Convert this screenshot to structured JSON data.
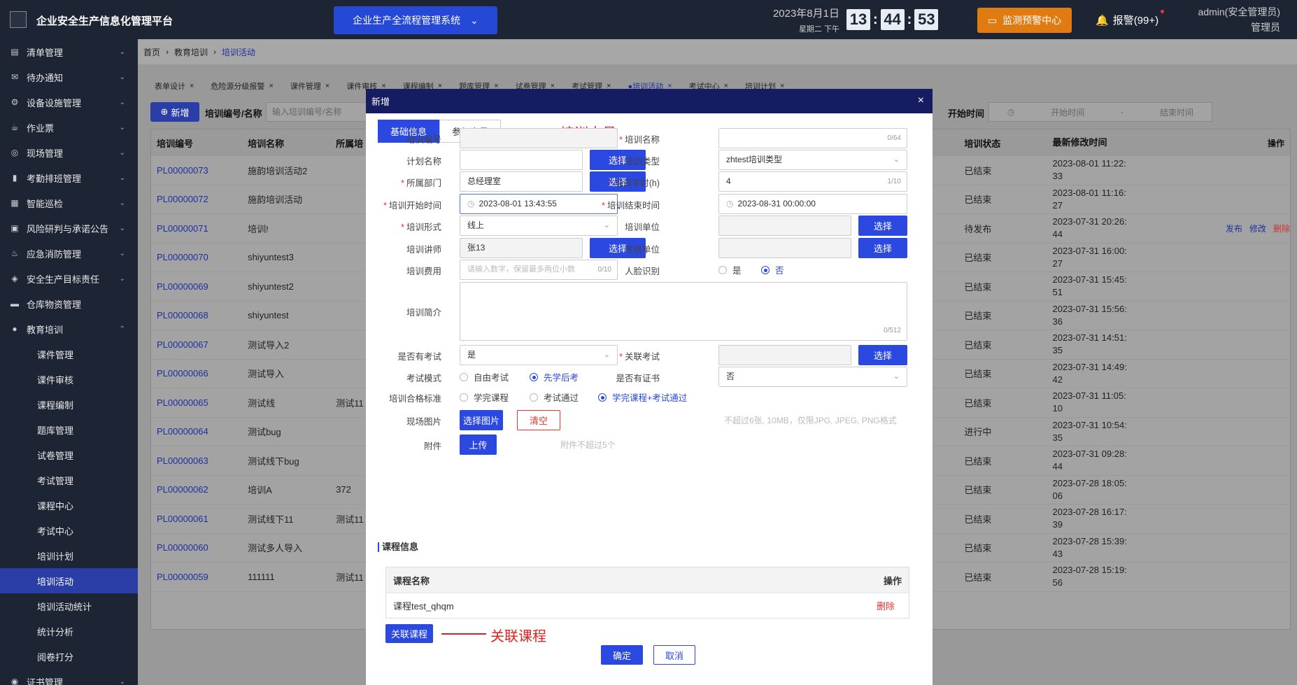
{
  "header": {
    "title": "企业安全生产信息化管理平台",
    "system_btn": "企业生产全流程管理系统",
    "date": "2023年8月1日",
    "weekday": "星期二  下午",
    "clock": {
      "h": "13",
      "m": "44",
      "s": "53"
    },
    "monitor_btn": "监测预警中心",
    "alarm": "报警(99+)",
    "user": "admin(安全管理员)",
    "role": "管理员"
  },
  "sidebar": {
    "items": [
      {
        "label": "清单管理",
        "icon": "clipboard-icon"
      },
      {
        "label": "待办通知",
        "icon": "mail-icon"
      },
      {
        "label": "设备设施管理",
        "icon": "sitemap-icon"
      },
      {
        "label": "作业票",
        "icon": "ticket-icon"
      },
      {
        "label": "现场管理",
        "icon": "globe-icon"
      },
      {
        "label": "考勤排班管理",
        "icon": "bar-chart-icon"
      },
      {
        "label": "智能巡检",
        "icon": "grid-icon"
      },
      {
        "label": "风险研判与承诺公告",
        "icon": "briefcase-icon"
      },
      {
        "label": "应急消防管理",
        "icon": "extinguisher-icon"
      },
      {
        "label": "安全生产目标责任",
        "icon": "target-icon"
      },
      {
        "label": "仓库物资管理",
        "icon": "folder-icon"
      },
      {
        "label": "教育培训",
        "icon": "user-icon"
      }
    ],
    "sub": [
      "课件管理",
      "课件审核",
      "课程编制",
      "题库管理",
      "试卷管理",
      "考试管理",
      "课程中心",
      "考试中心",
      "培训计划",
      "培训活动",
      "培训活动统计",
      "统计分析",
      "阅卷打分"
    ],
    "last": "证书管理"
  },
  "breadcrumb": [
    "首页",
    "教育培训",
    "培训活动"
  ],
  "tabs": [
    "表单设计",
    "危险源分级报警",
    "课件管理",
    "课件审核",
    "课程编制",
    "题库管理",
    "试卷管理",
    "考试管理",
    "●培训活动",
    "考试中心",
    "培训计划"
  ],
  "toolbar": {
    "add": "新增",
    "code_label": "培训编号/名称",
    "code_ph": "输入培训编号/名称",
    "time_label": "开始时间",
    "start_ph": "开始时间",
    "range_sep": "-",
    "end_ph": "结束时间"
  },
  "table": {
    "headers": [
      "培训编号",
      "培训名称",
      "所属培",
      "培训状态",
      "最新修改时间",
      "操作"
    ],
    "rows": [
      {
        "code": "PL00000073",
        "name": "施韵培训活动2",
        "dept": "",
        "status": "已结束",
        "t1": "2023-08-01 11:22:",
        "t2": "33",
        "ops": []
      },
      {
        "code": "PL00000072",
        "name": "施韵培训活动",
        "dept": "",
        "status": "已结束",
        "t1": "2023-08-01 11:16:",
        "t2": "27",
        "ops": []
      },
      {
        "code": "PL00000071",
        "name": "培训!",
        "dept": "",
        "status": "待发布",
        "t1": "2023-07-31 20:26:",
        "t2": "44",
        "ops": [
          "发布",
          "修改",
          "删除"
        ]
      },
      {
        "code": "PL00000070",
        "name": "shiyuntest3",
        "dept": "",
        "status": "已结束",
        "t1": "2023-07-31 16:00:",
        "t2": "27",
        "ops": []
      },
      {
        "code": "PL00000069",
        "name": "shiyuntest2",
        "dept": "",
        "status": "已结束",
        "t1": "2023-07-31 15:45:",
        "t2": "51",
        "ops": []
      },
      {
        "code": "PL00000068",
        "name": "shiyuntest",
        "dept": "",
        "status": "已结束",
        "t1": "2023-07-31 15:56:",
        "t2": "36",
        "ops": []
      },
      {
        "code": "PL00000067",
        "name": "测试导入2",
        "dept": "",
        "status": "已结束",
        "t1": "2023-07-31 14:51:",
        "t2": "35",
        "ops": []
      },
      {
        "code": "PL00000066",
        "name": "测试导入",
        "dept": "",
        "status": "已结束",
        "t1": "2023-07-31 14:49:",
        "t2": "42",
        "ops": []
      },
      {
        "code": "PL00000065",
        "name": "测试线",
        "dept": "测试11",
        "status": "已结束",
        "t1": "2023-07-31 11:05:",
        "t2": "10",
        "ops": []
      },
      {
        "code": "PL00000064",
        "name": "测试bug",
        "dept": "",
        "status": "进行中",
        "t1": "2023-07-31 10:54:",
        "t2": "35",
        "ops": []
      },
      {
        "code": "PL00000063",
        "name": "测试线下bug",
        "dept": "",
        "status": "已结束",
        "t1": "2023-07-31 09:28:",
        "t2": "44",
        "ops": []
      },
      {
        "code": "PL00000062",
        "name": "培训A",
        "dept": "372",
        "status": "已结束",
        "t1": "2023-07-28 18:05:",
        "t2": "06",
        "ops": []
      },
      {
        "code": "PL00000061",
        "name": "测试线下11",
        "dept": "测试11",
        "status": "已结束",
        "t1": "2023-07-28 16:17:",
        "t2": "39",
        "ops": []
      },
      {
        "code": "PL00000060",
        "name": "测试多人导入",
        "dept": "",
        "status": "已结束",
        "t1": "2023-07-28 15:39:",
        "t2": "43",
        "ops": []
      },
      {
        "code": "PL00000059",
        "name": "111111",
        "dept": "测试11",
        "status": "已结束",
        "t1": "2023-07-28 15:19:",
        "t2": "56",
        "ops": []
      }
    ]
  },
  "modal": {
    "title": "新增",
    "close": "×",
    "tabs": [
      "基础信息",
      "参与人员"
    ],
    "anno_people": "培训人员",
    "anno_course": "关联课程",
    "labels": {
      "code": "培训编号",
      "name": "培训名称",
      "plan": "计划名称",
      "type": "培训类型",
      "dept": "所属部门",
      "hours": "培训学时(h)",
      "start": "培训开始时间",
      "end": "培训结束时间",
      "form": "培训形式",
      "unit": "培训单位",
      "teacher": "培训讲师",
      "exam_unit": "考核单位",
      "fee": "培训费用",
      "face": "人脸识别",
      "intro": "培训简介",
      "has_exam": "是否有考试",
      "rel_exam": "关联考试",
      "exam_mode": "考试模式",
      "has_cert": "是否有证书",
      "pass": "培训合格标准",
      "photo": "现场图片",
      "attach": "附件"
    },
    "values": {
      "name_cnt": "0/64",
      "type": "zhtest培训类型",
      "dept": "总经理室",
      "hours": "4",
      "hours_cnt": "1/10",
      "start": "2023-08-01 13:43:55",
      "end": "2023-08-31 00:00:00",
      "form": "线上",
      "teacher": "张13",
      "fee_ph": "请输入数字，保留最多两位小数",
      "fee_cnt": "0/10",
      "intro_cnt": "0/512",
      "has_exam": "是",
      "has_cert": "否"
    },
    "radios": {
      "yes": "是",
      "no": "否",
      "free": "自由考试",
      "learn_first": "先学后考",
      "finish": "学完课程",
      "pass_exam": "考试通过",
      "both": "学完课程+考试通过"
    },
    "buttons": {
      "select": "选择",
      "select_img": "选择图片",
      "clear": "清空",
      "upload": "上传",
      "rel_course": "关联课程",
      "ok": "确定",
      "cancel": "取消"
    },
    "hints": {
      "img": "不超过6张, 10MB，仅限JPG, JPEG, PNG格式",
      "attach": "附件不超过5个"
    },
    "course_section": "课程信息",
    "course_table": {
      "col1": "课程名称",
      "col2": "操作",
      "row": "课程test_qhqm",
      "del": "删除"
    }
  },
  "colors": {
    "topbar": "#1d2433",
    "accent": "#2b48e0",
    "modal_header": "#151c62",
    "annotation": "#dd2222",
    "warning": "#e07b12"
  }
}
